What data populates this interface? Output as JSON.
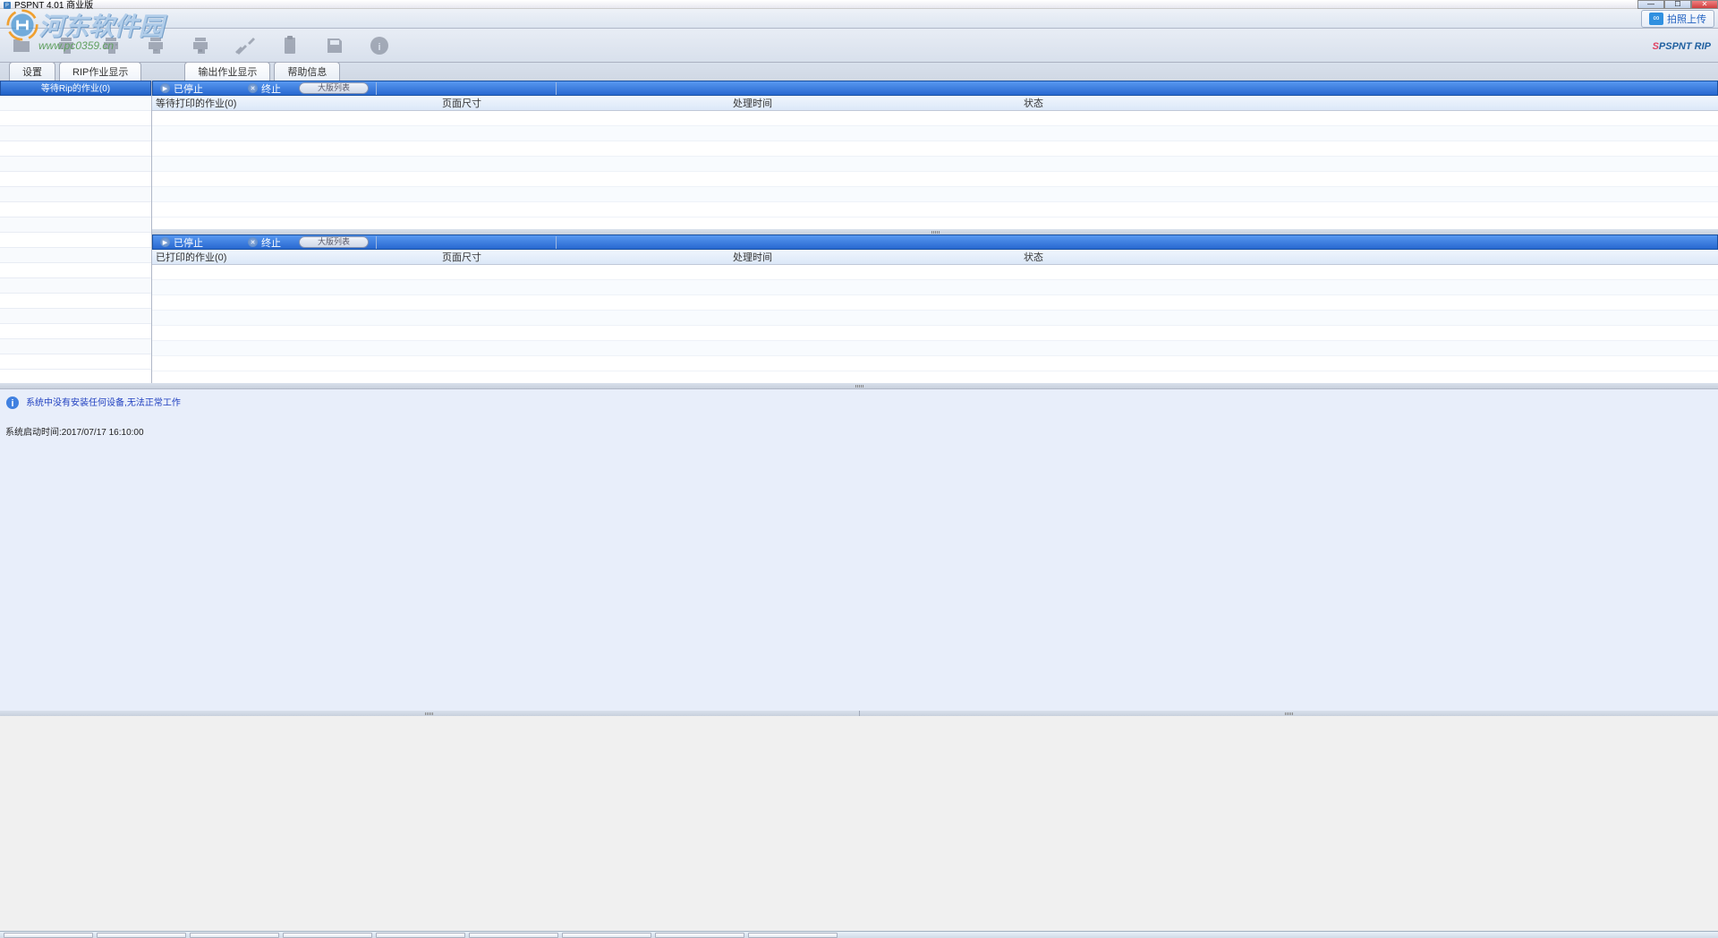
{
  "title": "PSPNT 4.01 商业版",
  "watermark": {
    "text": "河东软件园",
    "url": "www.pc0359.cn"
  },
  "upload_button": "拍照上传",
  "brand": "PSPNT RIP",
  "tabs_left": [
    {
      "label": "设置"
    },
    {
      "label": "RIP作业显示"
    }
  ],
  "tabs_right": [
    {
      "label": "输出作业显示"
    },
    {
      "label": "帮助信息"
    }
  ],
  "sidebar": {
    "header": "等待Rip的作业(0)"
  },
  "section1": {
    "paused": "已停止",
    "stop": "终止",
    "layout_btn": "大版列表",
    "columns": {
      "c1": "等待打印的作业(0)",
      "c2": "页面尺寸",
      "c3": "处理时间",
      "c4": "状态"
    }
  },
  "section2": {
    "paused": "已停止",
    "stop": "终止",
    "layout_btn": "大版列表",
    "columns": {
      "c1": "已打印的作业(0)",
      "c2": "页面尺寸",
      "c3": "处理时间",
      "c4": "状态"
    }
  },
  "log": {
    "message": "系统中没有安装任何设备,无法正常工作",
    "start_time": "系统启动时间:2017/07/17 16:10:00"
  }
}
